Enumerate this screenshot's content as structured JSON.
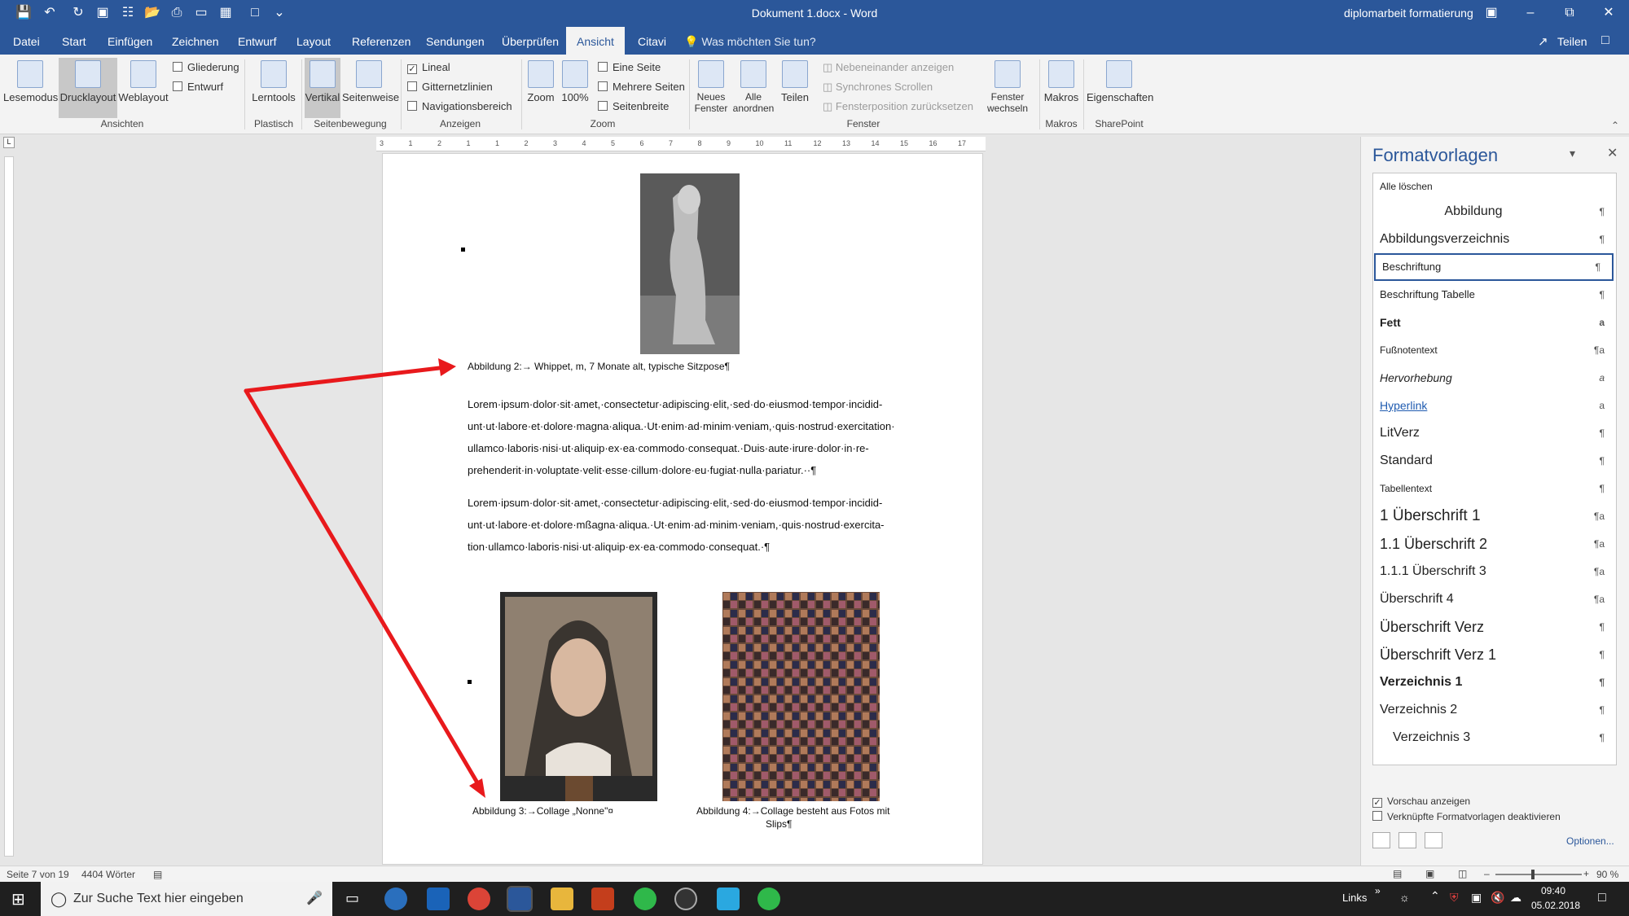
{
  "window": {
    "doc_title": "Dokument 1.docx  -  Word",
    "right_title": "diplomarbeit formatierung"
  },
  "menu": {
    "tabs": [
      "Datei",
      "Start",
      "Einfügen",
      "Zeichnen",
      "Entwurf",
      "Layout",
      "Referenzen",
      "Sendungen",
      "Überprüfen",
      "Ansicht",
      "Citavi"
    ],
    "active": "Ansicht",
    "tellme": "Was möchten Sie tun?",
    "share": "Teilen"
  },
  "ribbon": {
    "ansichten": {
      "lesemodus": "Lesemodus",
      "drucklayout": "Drucklayout",
      "weblayout": "Weblayout",
      "gliederung": "Gliederung",
      "entwurf": "Entwurf",
      "group": "Ansichten"
    },
    "plastisch": {
      "lerntools": "Lerntools",
      "group": "Plastisch"
    },
    "seitenbewegung": {
      "vertikal": "Vertikal",
      "seitenweise": "Seitenweise",
      "group": "Seitenbewegung"
    },
    "anzeigen": {
      "lineal": "Lineal",
      "gitternetzlinien": "Gitternetzlinien",
      "navigationsbereich": "Navigationsbereich",
      "group": "Anzeigen"
    },
    "zoom": {
      "zoom": "Zoom",
      "hundred": "100%",
      "eine_seite": "Eine Seite",
      "mehrere_seiten": "Mehrere Seiten",
      "seitenbreite": "Seitenbreite",
      "group": "Zoom"
    },
    "fenster": {
      "neues_fenster": [
        "Neues",
        "Fenster"
      ],
      "alle_anordnen": [
        "Alle",
        "anordnen"
      ],
      "teilen": "Teilen",
      "nebeneinander": "Nebeneinander anzeigen",
      "synchron": "Synchrones Scrollen",
      "fensterposition": "Fensterposition zurücksetzen",
      "fenster_wechseln": [
        "Fenster",
        "wechseln"
      ],
      "group": "Fenster"
    },
    "makros": {
      "makros": "Makros",
      "group": "Makros"
    },
    "sharepoint": {
      "eigenschaften": "Eigenschaften",
      "group": "SharePoint"
    }
  },
  "ruler": {
    "labels": [
      "3",
      "1",
      "2",
      "1",
      "1",
      "2",
      "3",
      "4",
      "5",
      "6",
      "7",
      "8",
      "9",
      "10",
      "11",
      "12",
      "13",
      "14",
      "15",
      "16",
      "17"
    ]
  },
  "document": {
    "caption2": "Abbildung 2:→ Whippet, m, 7 Monate alt, typische Sitzpose¶",
    "para1": [
      "Lorem·ipsum·dolor·sit·amet,·consectetur·adipiscing·elit,·sed·do·eiusmod·tempor·incidid-",
      "unt·ut·labore·et·dolore·magna·aliqua.·Ut·enim·ad·minim·veniam,·quis·nostrud·exercitation·",
      "ullamco·laboris·nisi·ut·aliquip·ex·ea·commodo·consequat.·Duis·aute·irure·dolor·in·re-",
      "prehenderit·in·voluptate·velit·esse·cillum·dolore·eu·fugiat·nulla·pariatur.··¶"
    ],
    "para2": [
      "Lorem·ipsum·dolor·sit·amet,·consectetur·adipiscing·elit,·sed·do·eiusmod·tempor·incidid-",
      "unt·ut·labore·et·dolore·mßagna·aliqua.·Ut·enim·ad·minim·veniam,·quis·nostrud·exercita-",
      "tion·ullamco·laboris·nisi·ut·aliquip·ex·ea·commodo·consequat.·¶"
    ],
    "caption3": "Abbildung 3:→Collage „Nonne\"¤",
    "caption4_line1": "Abbildung 4:→Collage besteht aus Fotos mit",
    "caption4_line2": "Slips¶"
  },
  "panel": {
    "title": "Formatvorlagen",
    "clear_all": "Alle löschen",
    "styles": [
      {
        "name": "Abbildung",
        "mark": "¶"
      },
      {
        "name": "Abbildungsverzeichnis",
        "mark": "¶"
      },
      {
        "name": "Beschriftung",
        "mark": "¶"
      },
      {
        "name": "Beschriftung Tabelle",
        "mark": "¶"
      },
      {
        "name": "Fett",
        "mark": "a"
      },
      {
        "name": "Fußnotentext",
        "mark": "¶a"
      },
      {
        "name": "Hervorhebung",
        "mark": "a"
      },
      {
        "name": "Hyperlink",
        "mark": "a"
      },
      {
        "name": "LitVerz",
        "mark": "¶"
      },
      {
        "name": "Standard",
        "mark": "¶"
      },
      {
        "name": "Tabellentext",
        "mark": "¶"
      },
      {
        "name": "1  Überschrift 1",
        "mark": "¶a"
      },
      {
        "name": "1.1  Überschrift 2",
        "mark": "¶a"
      },
      {
        "name": "1.1.1  Überschrift 3",
        "mark": "¶a"
      },
      {
        "name": "Überschrift 4",
        "mark": "¶a"
      },
      {
        "name": "Überschrift Verz",
        "mark": "¶"
      },
      {
        "name": "Überschrift Verz 1",
        "mark": "¶"
      },
      {
        "name": "Verzeichnis 1",
        "mark": "¶"
      },
      {
        "name": "Verzeichnis 2",
        "mark": "¶"
      },
      {
        "name": "Verzeichnis 3",
        "mark": "¶"
      }
    ],
    "selected": "Beschriftung",
    "vorschau": "Vorschau anzeigen",
    "verknuepft": "Verknüpfte Formatvorlagen deaktivieren",
    "optionen": "Optionen..."
  },
  "status": {
    "page": "Seite 7 von 19",
    "words": "4404 Wörter",
    "zoom": "90 %"
  },
  "taskbar": {
    "search": "Zur Suche Text hier eingeben",
    "links": "Links",
    "time": "09:40",
    "date": "05.02.2018"
  }
}
